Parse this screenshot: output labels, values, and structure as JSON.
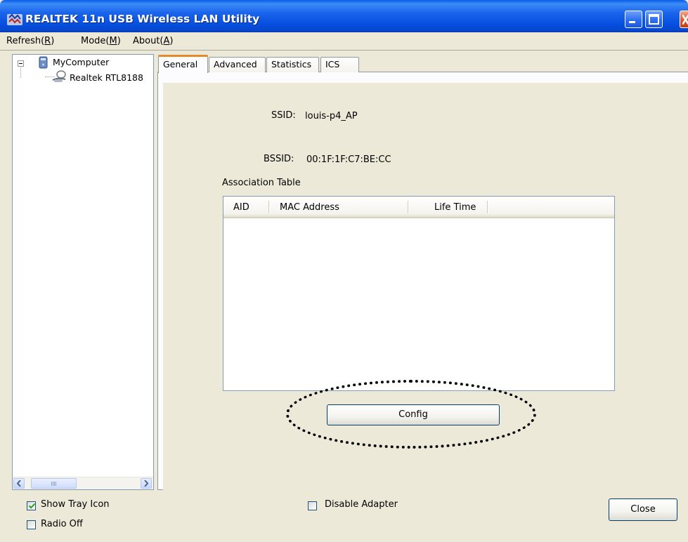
{
  "window": {
    "title": "REALTEK 11n USB Wireless LAN Utility"
  },
  "menu": {
    "refresh_label": "Refresh(",
    "refresh_key": "R",
    "mode_label": "Mode(",
    "mode_key": "M",
    "about_label": "About(",
    "about_key": "A",
    "close_paren": ")"
  },
  "tree": {
    "root_label": "MyComputer",
    "child_label": "Realtek RTL8188"
  },
  "tabs": [
    {
      "label": "General",
      "active": true
    },
    {
      "label": "Advanced",
      "active": false
    },
    {
      "label": "Statistics",
      "active": false
    },
    {
      "label": "ICS",
      "active": false
    }
  ],
  "general": {
    "ssid_label": "SSID:",
    "ssid_value": "louis-p4_AP",
    "bssid_label": "BSSID:",
    "bssid_value": "00:1F:1F:C7:BE:CC",
    "association_table_label": "Association Table",
    "columns": [
      "AID",
      "MAC Address",
      "Life Time"
    ],
    "rows": [],
    "config_button": "Config"
  },
  "footer": {
    "show_tray_icon_label": "Show Tray Icon",
    "show_tray_icon_checked": true,
    "radio_off_label": "Radio Off",
    "radio_off_checked": false,
    "disable_adapter_label": "Disable Adapter",
    "disable_adapter_checked": false,
    "close_button": "Close"
  },
  "colors": {
    "title_bar": "#0a5ce9",
    "active_tab_accent": "#e68b2c",
    "window_face": "#ece9d8"
  }
}
